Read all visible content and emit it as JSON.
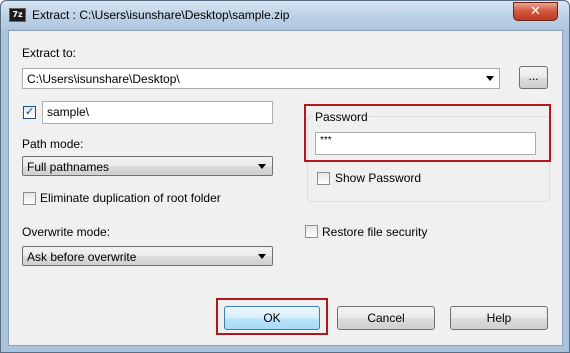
{
  "window": {
    "icon_text": "7z",
    "title": "Extract : C:\\Users\\isunshare\\Desktop\\sample.zip",
    "close_glyph": "✕"
  },
  "extract_to": {
    "label": "Extract to:",
    "path": "C:\\Users\\isunshare\\Desktop\\",
    "browse_label": "..."
  },
  "subfolder": {
    "checked": true,
    "value": "sample\\"
  },
  "path_mode": {
    "label": "Path mode:",
    "selected": "Full pathnames"
  },
  "eliminate_duplication": {
    "label": "Eliminate duplication of root folder",
    "checked": false
  },
  "overwrite_mode": {
    "label": "Overwrite mode:",
    "selected": "Ask before overwrite"
  },
  "password": {
    "group_label": "Password",
    "value": "***",
    "show_password_label": "Show Password",
    "show_password_checked": false
  },
  "restore_security": {
    "label": "Restore file security",
    "checked": false
  },
  "buttons": {
    "ok": "OK",
    "cancel": "Cancel",
    "help": "Help"
  },
  "colors": {
    "highlight_frame": "#b4161c",
    "title_gradient": "#bcd1e6",
    "close_button": "#c23a22"
  }
}
